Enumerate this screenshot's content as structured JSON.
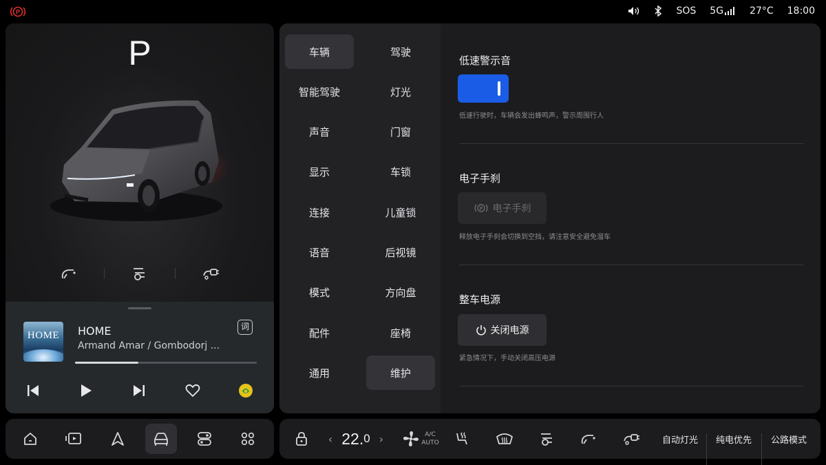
{
  "status_bar": {
    "parking_icon": "parking-brake-icon",
    "volume_icon": "volume-icon",
    "bluetooth_icon": "bluetooth-icon",
    "sos": "SOS",
    "network": "5G",
    "temperature": "27°C",
    "time": "18:00"
  },
  "vehicle": {
    "gear": "P",
    "quick_actions": [
      "fuel-door-icon",
      "charge-port-left-icon",
      "charge-port-right-icon"
    ]
  },
  "media": {
    "album_text": "HOME",
    "title": "HOME",
    "artist": "Armand Amar / Gombodorj ...",
    "lyrics_label": "词",
    "progress": 0.35
  },
  "menu": {
    "items": [
      "车辆",
      "驾驶",
      "智能驾驶",
      "灯光",
      "声音",
      "门窗",
      "显示",
      "车锁",
      "连接",
      "儿童锁",
      "语音",
      "后视镜",
      "模式",
      "方向盘",
      "配件",
      "座椅",
      "通用",
      "维护"
    ],
    "active_items": [
      "车辆",
      "维护"
    ]
  },
  "settings": {
    "low_speed_warning": {
      "title": "低速警示音",
      "enabled": true,
      "desc": "低速行驶时，车辆会发出蜂鸣声，警示周围行人"
    },
    "e_brake": {
      "title": "电子手刹",
      "button": "电子手刹",
      "desc": "释放电子手刹会切换到空挡，请注意安全避免溜车"
    },
    "power": {
      "title": "整车电源",
      "button": "关闭电源",
      "desc": "紧急情况下，手动关闭高压电源"
    }
  },
  "dock": {
    "apps": [
      "home-icon",
      "media-icon",
      "navigation-icon",
      "vehicle-icon",
      "apps-toggle-icon",
      "grid-icon"
    ],
    "active_app": "vehicle-icon",
    "temp_integer": "22.",
    "temp_decimal": "0",
    "ac_top": "A/C",
    "ac_bottom": "AUTO",
    "auto_light": "自动灯光",
    "ev_priority": "纯电优先",
    "road_mode": "公路模式"
  },
  "colors": {
    "accent_blue": "#1a5ce6",
    "park_red": "#e0302a",
    "music_app_yellow": "#e6c21a"
  }
}
